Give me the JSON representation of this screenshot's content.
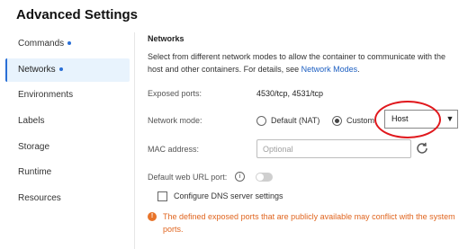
{
  "page": {
    "title": "Advanced Settings"
  },
  "sidebar": {
    "items": [
      {
        "label": "Commands",
        "dot": true
      },
      {
        "label": "Networks",
        "dot": true,
        "active": true
      },
      {
        "label": "Environments",
        "dot": false
      },
      {
        "label": "Labels",
        "dot": false
      },
      {
        "label": "Storage",
        "dot": false
      },
      {
        "label": "Runtime",
        "dot": false
      },
      {
        "label": "Resources",
        "dot": false
      }
    ]
  },
  "networks": {
    "section_title": "Networks",
    "description": "Select from different network modes to allow the container to communicate with the host and other containers. For details, see ",
    "description_link": "Network Modes",
    "description_end": ".",
    "exposed_ports_label": "Exposed ports:",
    "exposed_ports_value": "4530/tcp, 4531/tcp",
    "network_mode_label": "Network mode:",
    "mode_default_label": "Default (NAT)",
    "mode_custom_label": "Custom",
    "mode_selected": "Custom",
    "custom_select_value": "Host",
    "mac_label": "MAC address:",
    "mac_placeholder": "Optional",
    "mac_value": "",
    "default_web_url_label": "Default web URL port:",
    "default_web_url_enabled": false,
    "dns_checkbox_label": "Configure DNS server settings",
    "dns_checked": false,
    "warning": "The defined exposed ports that are publicly available may conflict with the system ports."
  },
  "colors": {
    "accent": "#2a6fd6",
    "link": "#1d5fc2",
    "warning": "#e0651f",
    "annotation": "#e0181d"
  },
  "icons": {
    "refresh": "refresh-icon",
    "info": "info-icon",
    "warning": "warning-icon",
    "dropdown": "chevron-down-icon"
  }
}
